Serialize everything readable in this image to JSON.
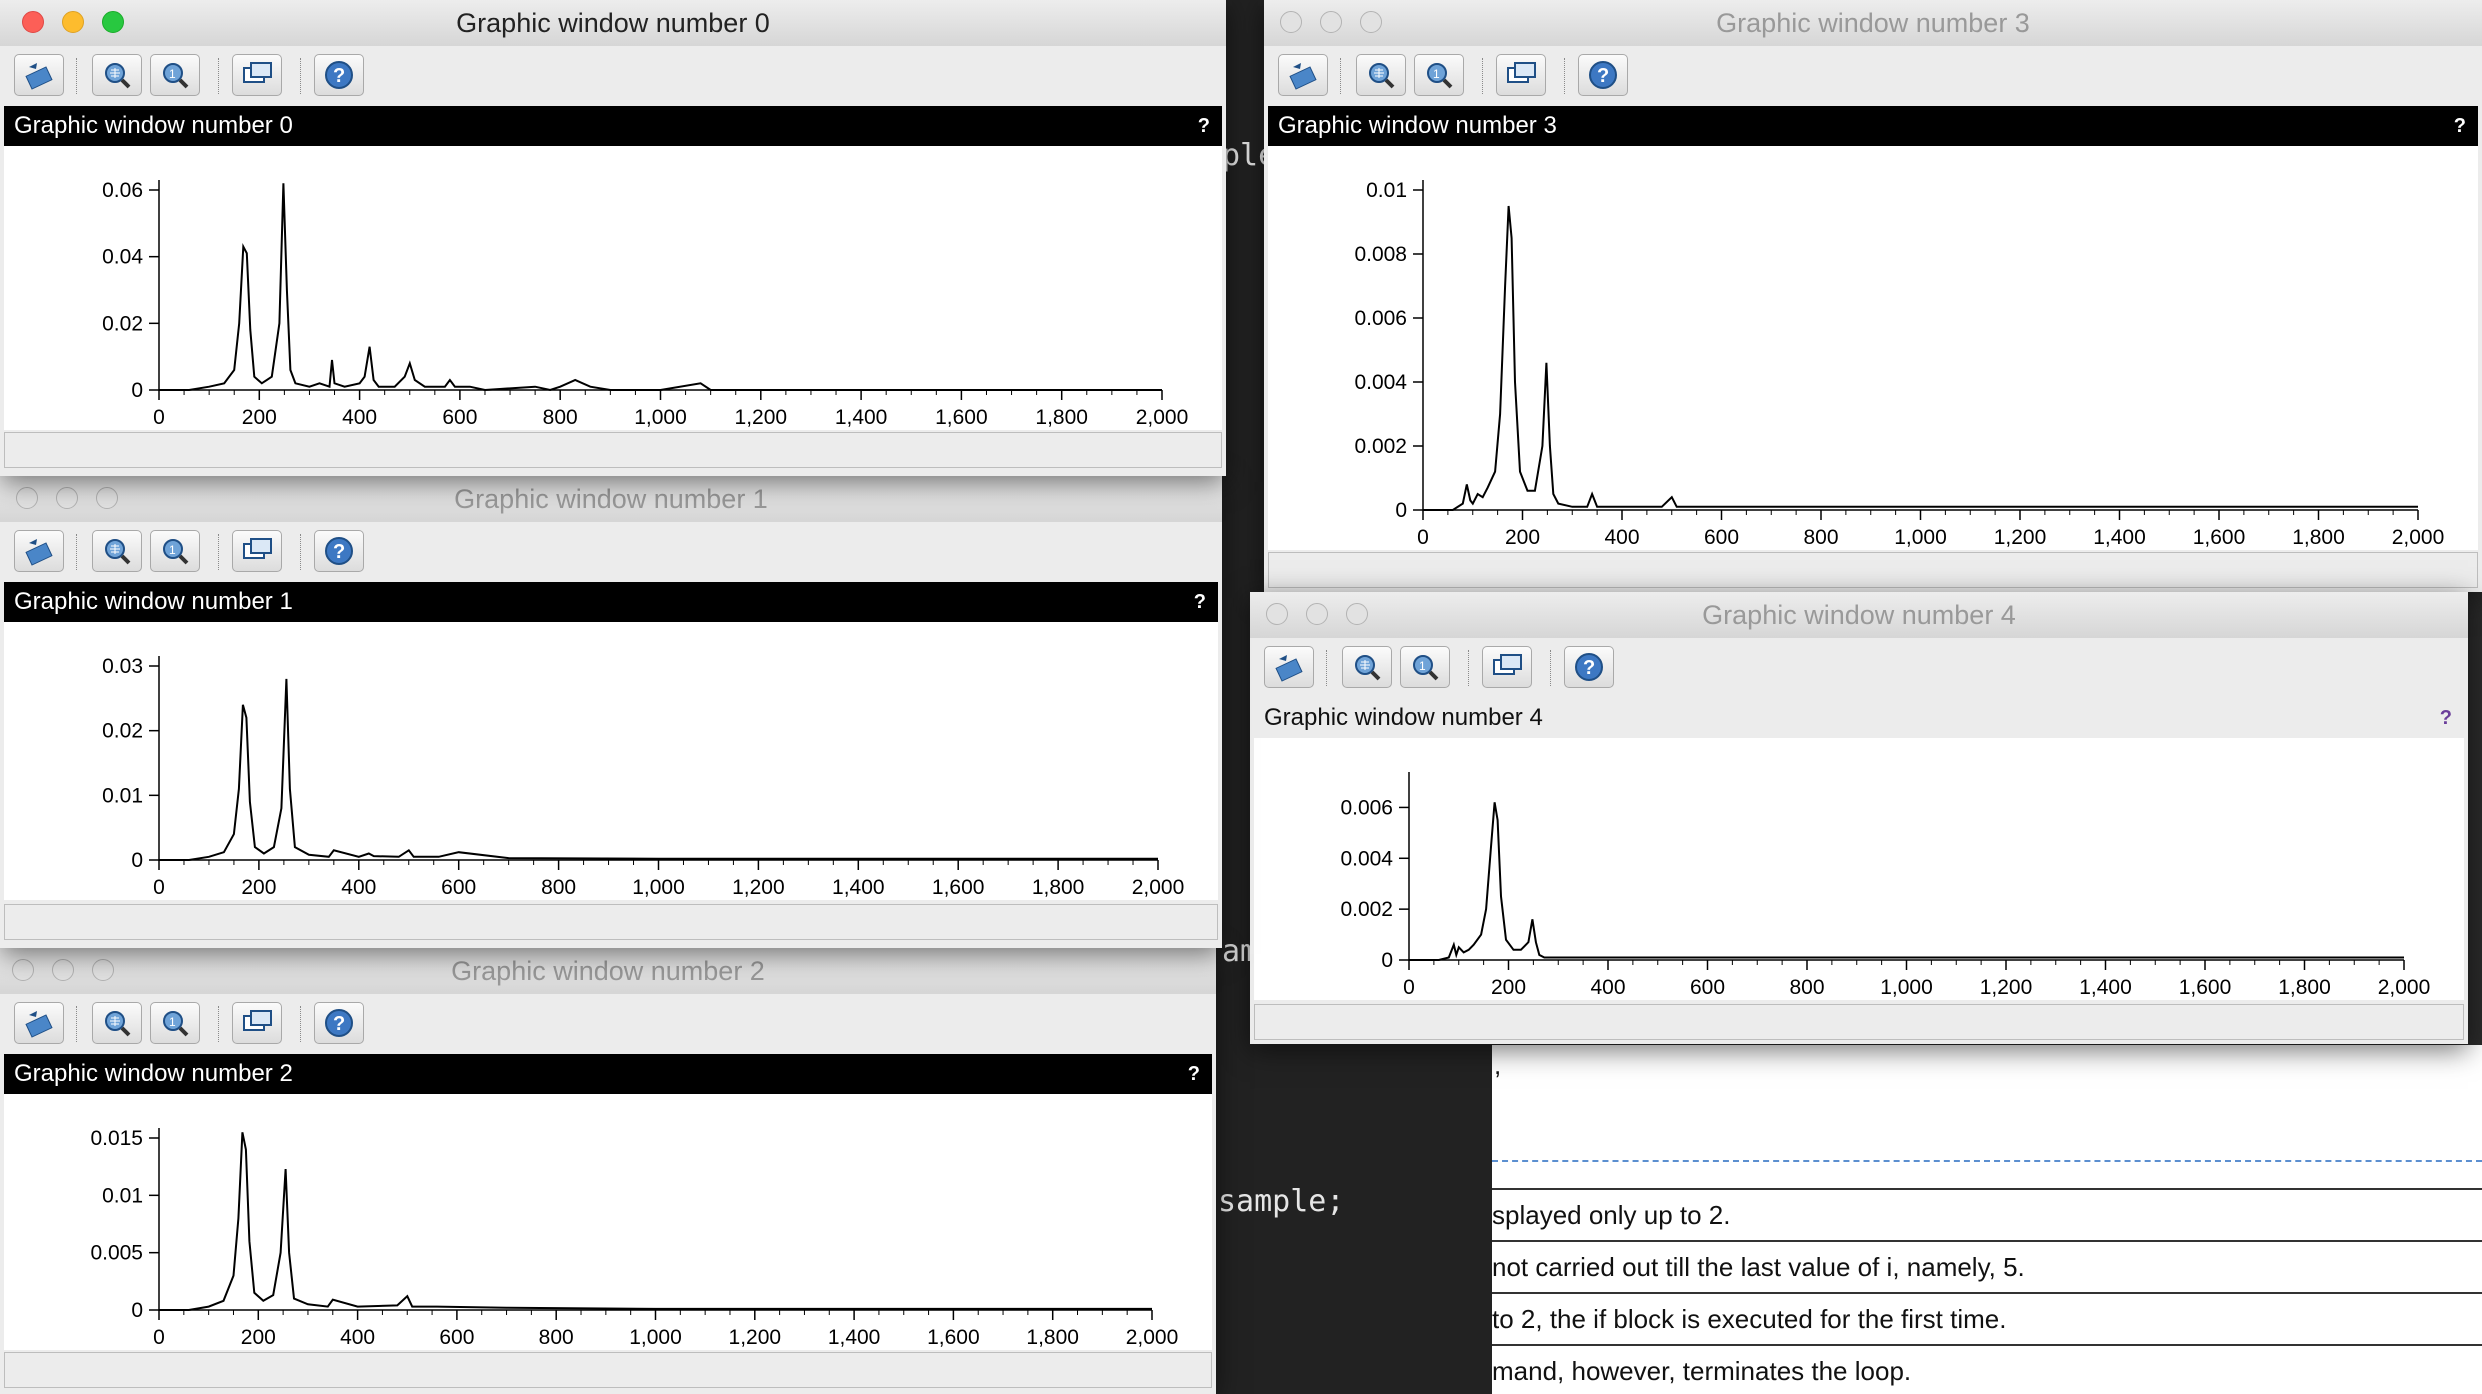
{
  "background": {
    "editor_lines": [
      "ple",
      "am",
      "sample;"
    ],
    "doc": {
      "lines": [
        "splayed only up to 2.",
        "not carried out till the last value of i, namely, 5.",
        " to 2, the if block is executed for the first time.",
        "mand, however, terminates the loop."
      ],
      "stray": ","
    }
  },
  "toolbar_icons": [
    "rotate-icon",
    "zoom-icon",
    "unzoom-icon",
    "dock-icon",
    "help-icon"
  ],
  "colors": {
    "dock_bar": "#000000",
    "plot_bg": "#ffffff",
    "line": "#000000"
  },
  "windows": [
    {
      "title": "Graphic window number 0",
      "dock_title": "Graphic window number 0",
      "help": "?",
      "chart_data": {
        "type": "line",
        "xlim": [
          0,
          2000
        ],
        "ylim": [
          0,
          0.06
        ],
        "x_ticks": [
          "0",
          "200",
          "400",
          "600",
          "800",
          "1,000",
          "1,200",
          "1,400",
          "1,600",
          "1,800",
          "2,000"
        ],
        "y_ticks": [
          "0",
          "0.02",
          "0.04",
          "0.06"
        ],
        "series": [
          {
            "x": [
              0,
              60,
              100,
              130,
              150,
              160,
              168,
              175,
              182,
              190,
              205,
              225,
              240,
              248,
              255,
              262,
              272,
              300,
              320,
              340,
              345,
              350,
              370,
              400,
              410,
              420,
              428,
              438,
              470,
              490,
              500,
              510,
              530,
              570,
              580,
              590,
              620,
              650,
              750,
              780,
              800,
              830,
              860,
              900,
              1000,
              1080,
              1100,
              1200,
              1400,
              1600,
              1800,
              2000
            ],
            "y": [
              0,
              0,
              0.001,
              0.002,
              0.006,
              0.02,
              0.043,
              0.041,
              0.018,
              0.004,
              0.002,
              0.004,
              0.02,
              0.062,
              0.03,
              0.006,
              0.002,
              0.001,
              0.002,
              0.001,
              0.009,
              0.002,
              0.001,
              0.002,
              0.004,
              0.013,
              0.003,
              0.001,
              0.001,
              0.004,
              0.008,
              0.003,
              0.001,
              0.001,
              0.003,
              0.001,
              0.001,
              0,
              0.001,
              0,
              0.001,
              0.003,
              0.001,
              0,
              0,
              0.002,
              0,
              0,
              0,
              0,
              0,
              0
            ]
          }
        ]
      }
    },
    {
      "title": "Graphic window number 1",
      "dock_title": "Graphic window number 1",
      "help": "?",
      "chart_data": {
        "type": "line",
        "xlim": [
          0,
          2000
        ],
        "ylim": [
          0,
          0.03
        ],
        "x_ticks": [
          "0",
          "200",
          "400",
          "600",
          "800",
          "1,000",
          "1,200",
          "1,400",
          "1,600",
          "1,800",
          "2,000"
        ],
        "y_ticks": [
          "0",
          "0.01",
          "0.02",
          "0.03"
        ],
        "series": [
          {
            "x": [
              0,
              60,
              100,
              130,
              150,
              160,
              168,
              175,
              182,
              192,
              210,
              230,
              245,
              255,
              262,
              272,
              300,
              340,
              350,
              400,
              420,
              430,
              480,
              500,
              510,
              560,
              600,
              700,
              1000,
              1300,
              1600,
              2000
            ],
            "y": [
              0,
              0,
              0.0005,
              0.0012,
              0.004,
              0.011,
              0.024,
              0.022,
              0.009,
              0.002,
              0.001,
              0.002,
              0.008,
              0.028,
              0.011,
              0.002,
              0.0008,
              0.0005,
              0.0015,
              0.0005,
              0.001,
              0.0006,
              0.0005,
              0.0015,
              0.0005,
              0.0005,
              0.0012,
              0.0003,
              0.0002,
              0.0002,
              0.0002,
              0.0002
            ]
          }
        ]
      }
    },
    {
      "title": "Graphic window number 2",
      "dock_title": "Graphic window number 2",
      "help": "?",
      "chart_data": {
        "type": "line",
        "xlim": [
          0,
          2000
        ],
        "ylim": [
          0,
          0.015
        ],
        "x_ticks": [
          "0",
          "200",
          "400",
          "600",
          "800",
          "1,000",
          "1,200",
          "1,400",
          "1,600",
          "1,800",
          "2,000"
        ],
        "y_ticks": [
          "0",
          "0.005",
          "0.01",
          "0.015"
        ],
        "series": [
          {
            "x": [
              0,
              60,
              100,
              130,
              150,
              160,
              168,
              175,
              182,
              192,
              210,
              230,
              245,
              255,
              262,
              272,
              300,
              340,
              350,
              400,
              480,
              500,
              510,
              560,
              700,
              1000,
              1300,
              2000
            ],
            "y": [
              0,
              0,
              0.0003,
              0.0008,
              0.003,
              0.008,
              0.0155,
              0.014,
              0.006,
              0.0015,
              0.0008,
              0.0013,
              0.005,
              0.0123,
              0.005,
              0.001,
              0.0005,
              0.0003,
              0.0009,
              0.0003,
              0.0004,
              0.0012,
              0.0003,
              0.0003,
              0.0002,
              0.0001,
              0.0001,
              0.0001
            ]
          }
        ]
      }
    },
    {
      "title": "Graphic window number 3",
      "dock_title": "Graphic window number 3",
      "help": "?",
      "chart_data": {
        "type": "line",
        "xlim": [
          0,
          2000
        ],
        "ylim": [
          0,
          0.01
        ],
        "x_ticks": [
          "0",
          "200",
          "400",
          "600",
          "800",
          "1,000",
          "1,200",
          "1,400",
          "1,600",
          "1,800",
          "2,000"
        ],
        "y_ticks": [
          "0",
          "0.002",
          "0.004",
          "0.006",
          "0.008",
          "0.01"
        ],
        "series": [
          {
            "x": [
              0,
              60,
              80,
              88,
              95,
              100,
              110,
              120,
              130,
              145,
              155,
              165,
              172,
              178,
              185,
              195,
              210,
              225,
              240,
              248,
              255,
              262,
              272,
              300,
              330,
              340,
              350,
              400,
              480,
              500,
              510,
              560,
              700,
              1000,
              1300,
              2000
            ],
            "y": [
              0,
              0,
              0.0002,
              0.0008,
              0.0003,
              0.0002,
              0.0005,
              0.0004,
              0.0007,
              0.0012,
              0.003,
              0.007,
              0.0095,
              0.0085,
              0.004,
              0.0012,
              0.0006,
              0.0006,
              0.002,
              0.0046,
              0.002,
              0.0005,
              0.0002,
              0.0001,
              0.0001,
              0.0005,
              0.0001,
              0.0001,
              0.0001,
              0.0004,
              0.0001,
              0.0001,
              0.0001,
              0.0001,
              0.0001,
              0.0001
            ]
          }
        ]
      }
    },
    {
      "title": "Graphic window number 4",
      "dock_title": "Graphic window number 4",
      "help": "?",
      "chart_data": {
        "type": "line",
        "xlim": [
          0,
          2000
        ],
        "ylim": [
          0,
          0.007
        ],
        "x_ticks": [
          "0",
          "200",
          "400",
          "600",
          "800",
          "1,000",
          "1,200",
          "1,400",
          "1,600",
          "1,800",
          "2,000"
        ],
        "y_ticks": [
          "0",
          "0.002",
          "0.004",
          "0.006"
        ],
        "series": [
          {
            "x": [
              0,
              60,
              80,
              90,
              95,
              100,
              110,
              120,
              130,
              145,
              155,
              165,
              172,
              178,
              185,
              195,
              210,
              225,
              240,
              248,
              255,
              262,
              272,
              300,
              350,
              400,
              500,
              700,
              1000,
              1300,
              2000
            ],
            "y": [
              0,
              0,
              0.0001,
              0.0006,
              0.0002,
              0.0005,
              0.0003,
              0.0004,
              0.0006,
              0.001,
              0.002,
              0.0045,
              0.0062,
              0.0055,
              0.0025,
              0.0008,
              0.0004,
              0.0004,
              0.0007,
              0.0016,
              0.0007,
              0.0002,
              0.0001,
              0.0001,
              0.0001,
              0.0001,
              0.0001,
              0.0001,
              0.0001,
              0.0001,
              0.0001
            ]
          }
        ]
      }
    }
  ]
}
